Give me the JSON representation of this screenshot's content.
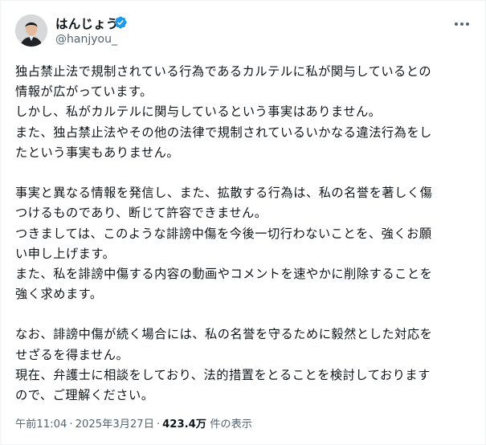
{
  "author": {
    "display_name": "はんじょう",
    "handle": "@hanjyou_",
    "verified": true
  },
  "header": {
    "more_icon": "more-dots-icon",
    "verified_icon": "verified-badge-icon"
  },
  "tweet": {
    "lines": [
      "独占禁止法で規制されている行為であるカルテルに私が関与しているとの",
      "情報が広がっています。",
      "しかし、私がカルテルに関与しているという事実はありません。",
      "また、独占禁止法やその他の法律で規制されているいかなる違法行為をし",
      "たという事実もありません。",
      "",
      "事実と異なる情報を発信し、また、拡散する行為は、私の名誉を著しく傷",
      "つけるものであり、断じて許容できません。",
      "つきましては、このような誹謗中傷を今後一切行わないことを、強くお願",
      "い申し上げます。",
      "また、私を誹謗中傷する内容の動画やコメントを速やかに削除することを",
      "強く求めます。",
      "",
      "なお、誹謗中傷が続く場合には、私の名誉を守るために毅然とした対応を",
      "せざるを得ません。",
      "現在、弁護士に相談をしており、法的措置をとることを検討しております",
      "ので、ご理解ください。"
    ]
  },
  "meta": {
    "time": "午前11:04",
    "separator": "·",
    "date": "2025年3月27日",
    "views_count": "423.4万",
    "views_label": "件の表示"
  },
  "colors": {
    "text": "#0f1419",
    "secondary": "#536471",
    "verified": "#1d9bf0",
    "border": "#eff3f4"
  }
}
